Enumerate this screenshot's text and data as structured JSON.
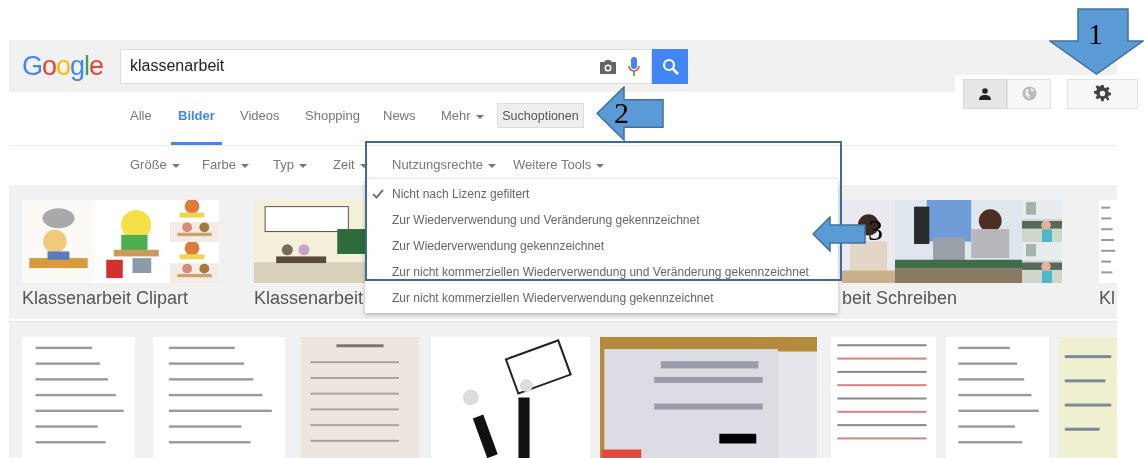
{
  "logo": "Google",
  "search": {
    "value": "klassenarbeit"
  },
  "account_modes": [
    {
      "kind": "person",
      "selected": true
    },
    {
      "kind": "globe",
      "selected": false
    }
  ],
  "tabs": [
    {
      "label": "Alle",
      "selected": false,
      "has_menu": false
    },
    {
      "label": "Bilder",
      "selected": true,
      "has_menu": false
    },
    {
      "label": "Videos",
      "selected": false,
      "has_menu": false
    },
    {
      "label": "Shopping",
      "selected": false,
      "has_menu": false
    },
    {
      "label": "News",
      "selected": false,
      "has_menu": false
    },
    {
      "label": "Mehr",
      "selected": false,
      "has_menu": true
    }
  ],
  "tools_button": {
    "label": "Suchoptionen"
  },
  "filters": [
    {
      "label": "Größe"
    },
    {
      "label": "Farbe"
    },
    {
      "label": "Typ"
    },
    {
      "label": "Zeit"
    },
    {
      "label": "Nutzungsrechte"
    },
    {
      "label": "Weitere Tools"
    }
  ],
  "license_menu": [
    {
      "label": "Nicht nach Lizenz gefiltert",
      "selected": true
    },
    {
      "label": "Zur Wiederverwendung und Veränderung gekennzeichnet",
      "selected": false
    },
    {
      "label": "Zur Wiederverwendung gekennzeichnet",
      "selected": false
    },
    {
      "label": "Zur nicht kommerziellen Wiederverwendung und Veränderung gekennzeichnet",
      "selected": false
    },
    {
      "label": "Zur nicht kommerziellen Wiederverwendung gekennzeichnet",
      "selected": false
    }
  ],
  "related_searches": [
    {
      "label": "Klassenarbeit Clipart"
    },
    {
      "label": "Klassenarbeit"
    },
    {
      "label": "beit Schreiben"
    },
    {
      "label": "Kl"
    }
  ],
  "annotations": [
    {
      "label": "1",
      "kind": "down"
    },
    {
      "label": "2",
      "kind": "left"
    },
    {
      "label": "3",
      "kind": "left"
    }
  ]
}
